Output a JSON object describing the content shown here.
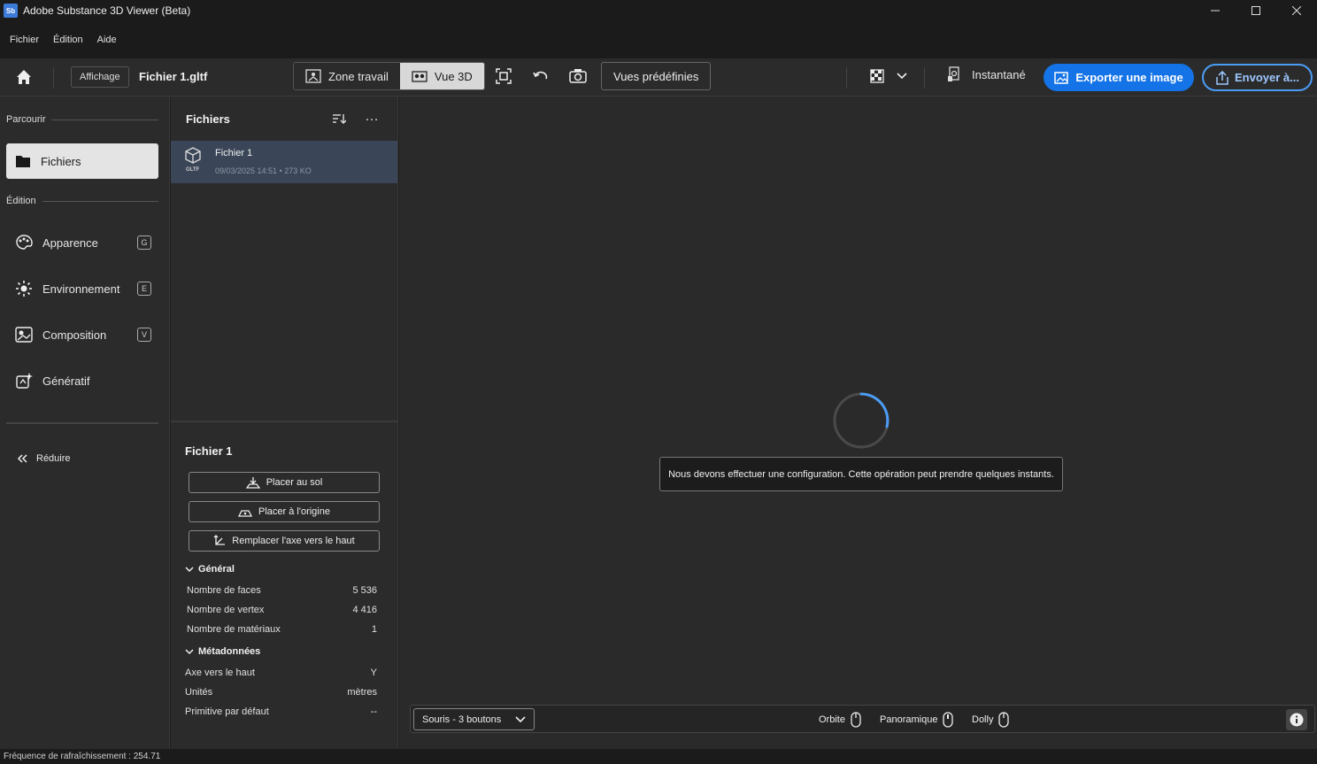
{
  "window": {
    "title": "Adobe Substance 3D Viewer (Beta)",
    "app_icon_label": "Sb"
  },
  "menu": {
    "items": [
      "Fichier",
      "Édition",
      "Aide"
    ]
  },
  "toolbar": {
    "affichage_label": "Affichage",
    "file_name": "Fichier 1.gltf",
    "zone_travail_label": "Zone travail",
    "vue_3d_label": "Vue 3D",
    "vues_predefinies_label": "Vues prédéfinies",
    "instantane_label": "Instantané",
    "export_label": "Exporter une image",
    "send_label": "Envoyer à..."
  },
  "leftnav": {
    "parcourir_heading": "Parcourir",
    "fichiers_label": "Fichiers",
    "edition_heading": "Édition",
    "items": [
      {
        "label": "Apparence",
        "shortcut": "G"
      },
      {
        "label": "Environnement",
        "shortcut": "E"
      },
      {
        "label": "Composition",
        "shortcut": "V"
      },
      {
        "label": "Génératif",
        "shortcut": ""
      }
    ],
    "reduire_label": "Réduire"
  },
  "files_panel": {
    "title": "Fichiers",
    "more_label": "…",
    "file": {
      "name": "Fichier 1",
      "type_badge": "GLTF",
      "meta": "09/03/2025 14:51 • 273 KO"
    },
    "props_title": "Fichier 1",
    "actions": [
      "Placer au sol",
      "Placer à l'origine",
      "Remplacer l'axe vers le haut"
    ],
    "general_heading": "Général",
    "general": [
      {
        "label": "Nombre de faces",
        "value": "5 536"
      },
      {
        "label": "Nombre de vertex",
        "value": "4 416"
      },
      {
        "label": "Nombre de matériaux",
        "value": "1"
      }
    ],
    "metadata_heading": "Métadonnées",
    "metadata": [
      {
        "label": "Axe vers le haut",
        "value": "Y"
      },
      {
        "label": "Unités",
        "value": "mètres"
      },
      {
        "label": "Primitive par défaut",
        "value": "--"
      }
    ]
  },
  "viewport": {
    "loading_message": "Nous devons effectuer une configuration. Cette opération peut prendre quelques instants.",
    "mouse_mode": "Souris - 3 boutons",
    "controls": [
      "Orbite",
      "Panoramique",
      "Dolly"
    ]
  },
  "status": {
    "refresh_rate": "Fréquence de rafraîchissement : 254.71"
  },
  "colors": {
    "accent": "#1473e6",
    "selected_row": "#3a4658",
    "spinner": "#4b9cf5"
  }
}
